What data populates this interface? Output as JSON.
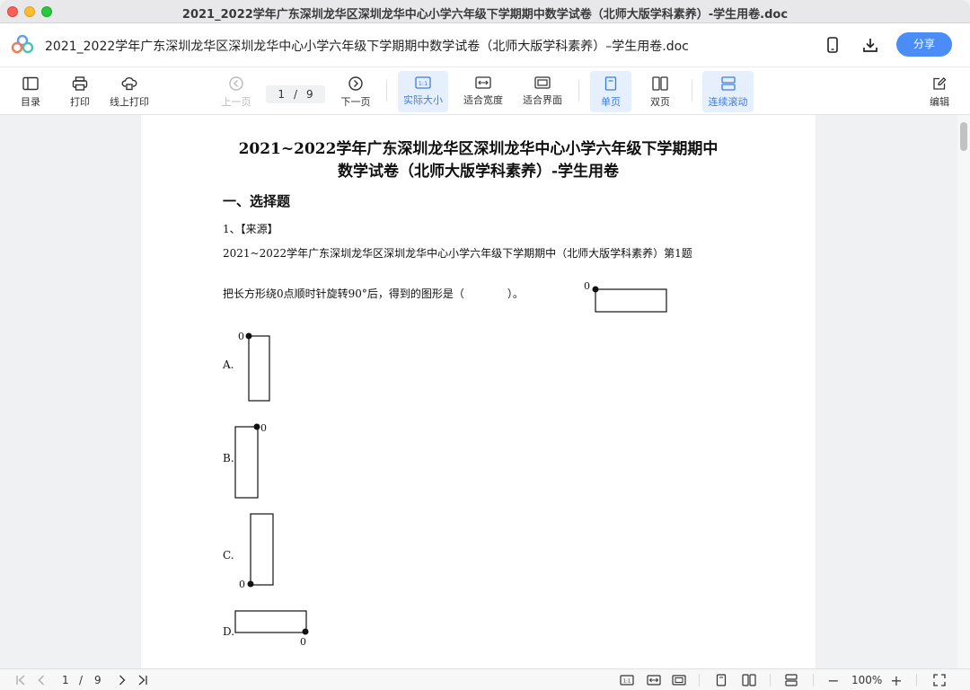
{
  "window": {
    "title": "2021_2022学年广东深圳龙华区深圳龙华中心小学六年级下学期期中数学试卷（北师大版学科素养）-学生用卷.doc"
  },
  "header": {
    "doc_title": "2021_2022学年广东深圳龙华区深圳龙华中心小学六年级下学期期中数学试卷（北师大版学科素养）–学生用卷.doc",
    "share_label": "分享",
    "icons": [
      "logo-icon",
      "phone-icon",
      "download-icon"
    ]
  },
  "toolbar": {
    "toc": "目录",
    "print": "打印",
    "online_print": "线上打印",
    "prev_page": "上一页",
    "page_current": "1",
    "page_sep": "/",
    "page_total": "9",
    "next_page": "下一页",
    "actual_size": "实际大小",
    "fit_width": "适合宽度",
    "fit_screen": "适合界面",
    "single_page": "单页",
    "double_page": "双页",
    "continuous_scroll": "连续滚动",
    "edit": "编辑"
  },
  "document": {
    "title_line1": "2021~2022学年广东深圳龙华区深圳龙华中心小学六年级下学期期中",
    "title_line2": "数学试卷（北师大版学科素养）-学生用卷",
    "section1": "一、选择题",
    "q1_header": "1、【来源】",
    "q1_source": "2021~2022学年广东深圳龙华区深圳龙华中心小学六年级下学期期中（北师大版学科素养）第1题",
    "q1_text": "把长方形绕0点顺时针旋转90°后，得到的图形是（　　　　）。",
    "point_label": "0",
    "options": {
      "a": "A.",
      "b": "B.",
      "c": "C.",
      "d": "D."
    }
  },
  "statusbar": {
    "page_current": "1",
    "page_sep": "/",
    "page_total": "9",
    "zoom": "100%",
    "zoom_minus": "−",
    "zoom_plus": "+"
  },
  "colors": {
    "accent": "#4a8df6",
    "active_bg": "#e6f0fc",
    "active_text": "#3c7be0"
  }
}
